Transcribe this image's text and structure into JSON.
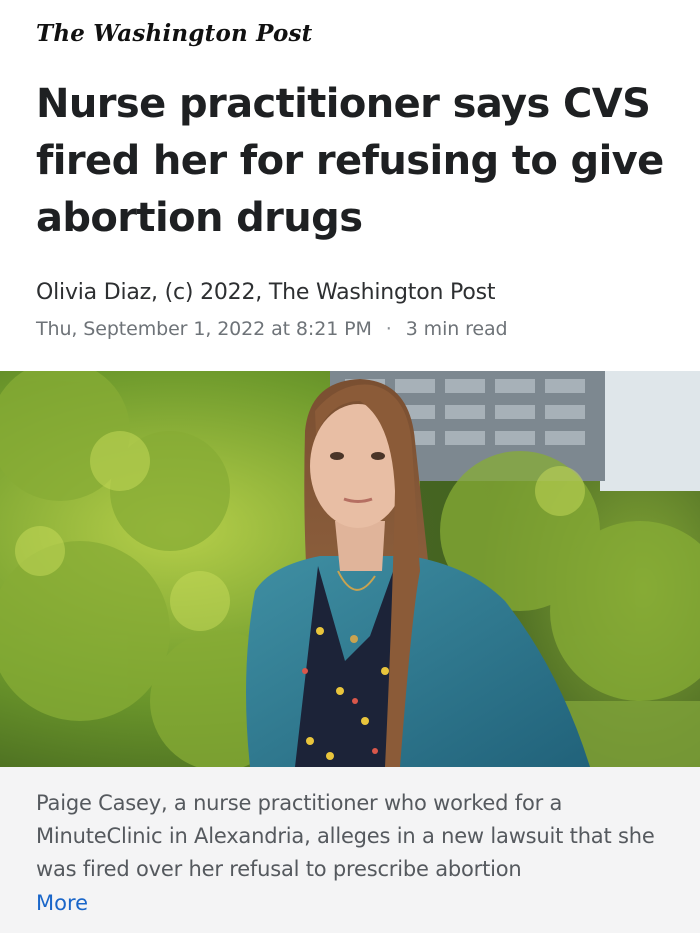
{
  "masthead": {
    "title": "The Washington Post"
  },
  "article": {
    "headline": "Nurse practitioner says CVS fired her for refusing to give abortion drugs",
    "byline": "Olivia Diaz, (c) 2022, The Washington Post",
    "date": "Thu, September 1, 2022 at 8:21 PM",
    "separator": "·",
    "read_time": "3 min read"
  },
  "photo": {
    "icon": "article-photo"
  },
  "caption": {
    "text": "Paige Casey, a nurse practitioner who worked for a MinuteClinic in Alexandria, alleges in a new lawsuit that she was fired over her refusal to prescribe abortion",
    "more_label": "More"
  },
  "colors": {
    "headline": "#1e2022",
    "meta": "#6e7378",
    "caption_bg": "#f4f4f5",
    "link": "#1a66c9"
  }
}
